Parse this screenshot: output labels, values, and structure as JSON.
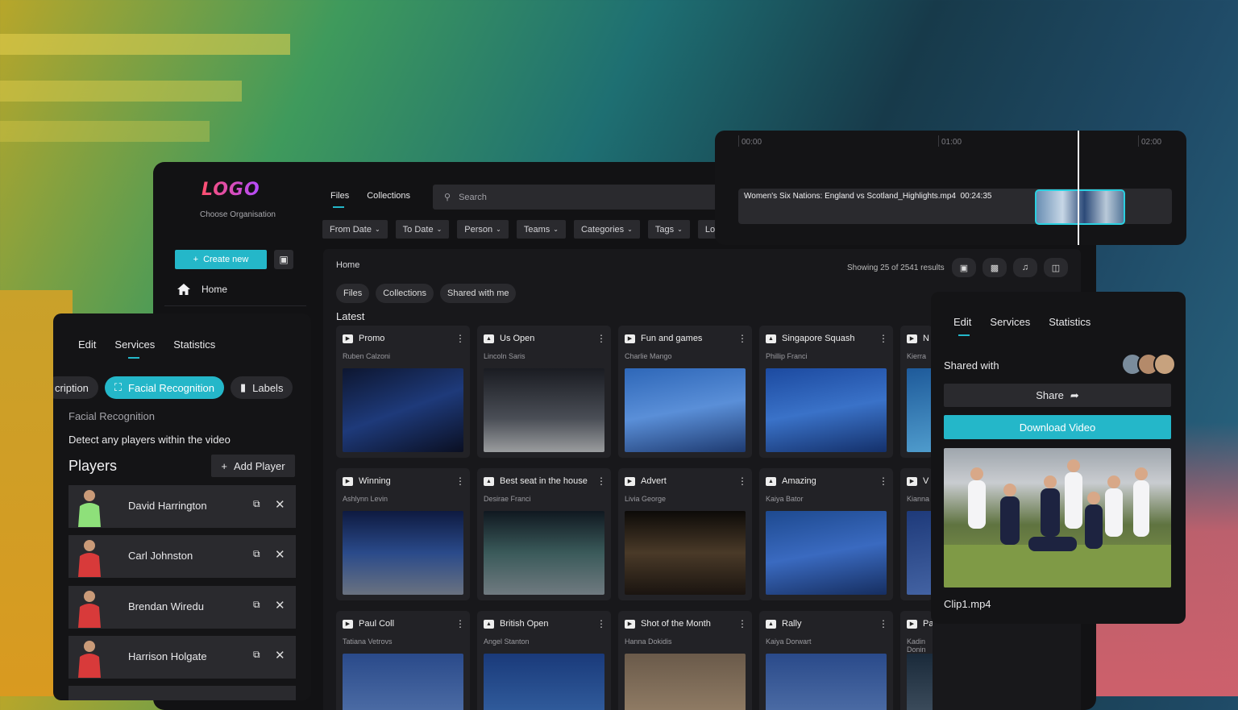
{
  "sidebar": {
    "logo": "LOGO",
    "org_label": "Choose Organisation",
    "create_label": "Create new",
    "home_label": "Home"
  },
  "topnav": {
    "tabs": [
      "Files",
      "Collections"
    ],
    "search_placeholder": "Search",
    "filters": [
      "From Date",
      "To Date",
      "Person",
      "Teams",
      "Categories",
      "Tags",
      "Lo"
    ]
  },
  "content": {
    "breadcrumb": "Home",
    "results": "Showing 25 of 2541 results",
    "pills": [
      "Files",
      "Collections",
      "Shared with me"
    ],
    "section": "Latest",
    "cards": [
      {
        "title": "Promo",
        "user": "Ruben Calzoni",
        "type": "video"
      },
      {
        "title": "Us Open",
        "user": "Lincoln Saris",
        "type": "image"
      },
      {
        "title": "Fun and games",
        "user": "Charlie Mango",
        "type": "video"
      },
      {
        "title": "Singapore Squash",
        "user": "Phillip Franci",
        "type": "image"
      },
      {
        "title": "N",
        "user": "Kierra",
        "type": "video"
      },
      {
        "title": "Winning",
        "user": "Ashlynn Levin",
        "type": "video"
      },
      {
        "title": "Best seat in the house",
        "user": "Desirae Franci",
        "type": "image"
      },
      {
        "title": "Advert",
        "user": "Livia George",
        "type": "video"
      },
      {
        "title": "Amazing",
        "user": "Kaiya Bator",
        "type": "image"
      },
      {
        "title": "V",
        "user": "Kianna",
        "type": "video"
      },
      {
        "title": "Paul Coll",
        "user": "Tatiana Vetrovs",
        "type": "video"
      },
      {
        "title": "British Open",
        "user": "Angel Stanton",
        "type": "image"
      },
      {
        "title": "Shot of the Month",
        "user": "Hanna Dokidis",
        "type": "video"
      },
      {
        "title": "Rally",
        "user": "Kaiya Dorwart",
        "type": "image"
      },
      {
        "title": "Paris Open",
        "user": "Kadin Donin",
        "type": "video"
      }
    ]
  },
  "timeline": {
    "ticks": [
      "00:00",
      "01:00",
      "02:00"
    ],
    "clip_label": "Women's Six Nations: England vs Scotland_Highlights.mp4",
    "clip_duration": "00:24:35"
  },
  "detail": {
    "tabs": [
      "Edit",
      "Services",
      "Statistics"
    ],
    "shared_with": "Shared with",
    "share_label": "Share",
    "download_label": "Download Video",
    "clip_name": "Clip1.mp4"
  },
  "players_panel": {
    "tabs": [
      "Edit",
      "Services",
      "Statistics"
    ],
    "features": [
      "cription",
      "Facial Recognition",
      "Labels"
    ],
    "feature_title": "Facial Recognition",
    "feature_desc": "Detect any players within the video",
    "heading": "Players",
    "add_label": "Add Player",
    "players": [
      {
        "name": "David Harrington",
        "kit": "#8ee07a"
      },
      {
        "name": "Carl Johnston",
        "kit": "#d83a3a"
      },
      {
        "name": "Brendan Wiredu",
        "kit": "#d83a3a"
      },
      {
        "name": "Harrison Holgate",
        "kit": "#d83a3a"
      }
    ]
  },
  "colors": {
    "accent": "#24b7c9",
    "panel": "#141416",
    "card": "#222226"
  }
}
